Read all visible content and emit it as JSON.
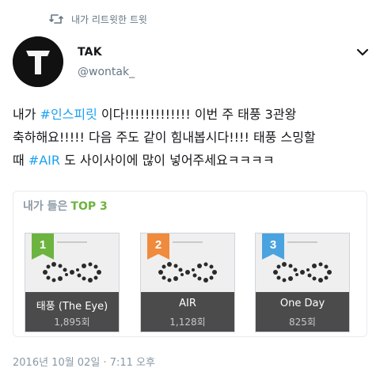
{
  "retweet_header": {
    "label": "내가 리트윗한 트윗",
    "icon": "retweet-icon"
  },
  "author": {
    "name": "TAK",
    "handle": "@wontak_",
    "avatar_letter": "T"
  },
  "menu": {
    "icon": "chevron-down-icon"
  },
  "tweet": {
    "line1_prefix": "내가 ",
    "hashtag1": "#인스피릿",
    "line1_suffix": " 이다!!!!!!!!!!!!! 이번 주 태풍 3관왕",
    "line2": "축하해요!!!!! 다음 주도 같이 힘내봅시다!!!! 태풍 스밍할",
    "line3_prefix": "때 ",
    "hashtag2": "#AIR",
    "line3_suffix": " 도 사이사이에 많이 넣어주세요ㅋㅋㅋㅋ"
  },
  "card": {
    "title_prefix": "내가 들은",
    "title_highlight": "TOP 3",
    "albums": [
      {
        "rank": "1",
        "rank_color": "#6db33f",
        "song": "태풍 (The Eye)",
        "plays": "1,895회"
      },
      {
        "rank": "2",
        "rank_color": "#f08a3c",
        "song": "AIR",
        "plays": "1,128회"
      },
      {
        "rank": "3",
        "rank_color": "#4aa3df",
        "song": "One Day",
        "plays": "825회"
      }
    ]
  },
  "timestamp": "2016년 10월 02일 · 7:11 오후",
  "colors": {
    "link": "#1da1f2",
    "muted": "#657786",
    "highlight": "#6db33f"
  }
}
